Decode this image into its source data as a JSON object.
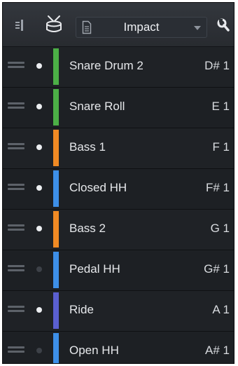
{
  "toolbar": {
    "expand_icon": "panel-expand-icon",
    "drum_icon": "drum-icon",
    "preset": {
      "icon": "document-icon",
      "name": "Impact"
    },
    "settings_icon": "wrench-icon"
  },
  "pads": [
    {
      "name": "Snare Drum 2",
      "note": "D# 1",
      "color": "#4caf46",
      "active": true
    },
    {
      "name": "Snare Roll",
      "note": "E 1",
      "color": "#4caf46",
      "active": true
    },
    {
      "name": "Bass 1",
      "note": "F 1",
      "color": "#f08a24",
      "active": true
    },
    {
      "name": "Closed HH",
      "note": "F# 1",
      "color": "#3d8fe8",
      "active": true
    },
    {
      "name": "Bass 2",
      "note": "G 1",
      "color": "#f08a24",
      "active": true
    },
    {
      "name": "Pedal HH",
      "note": "G# 1",
      "color": "#3d8fe8",
      "active": false
    },
    {
      "name": "Ride",
      "note": "A 1",
      "color": "#5a5fd0",
      "active": true
    },
    {
      "name": "Open HH",
      "note": "A# 1",
      "color": "#3d8fe8",
      "active": false
    }
  ]
}
